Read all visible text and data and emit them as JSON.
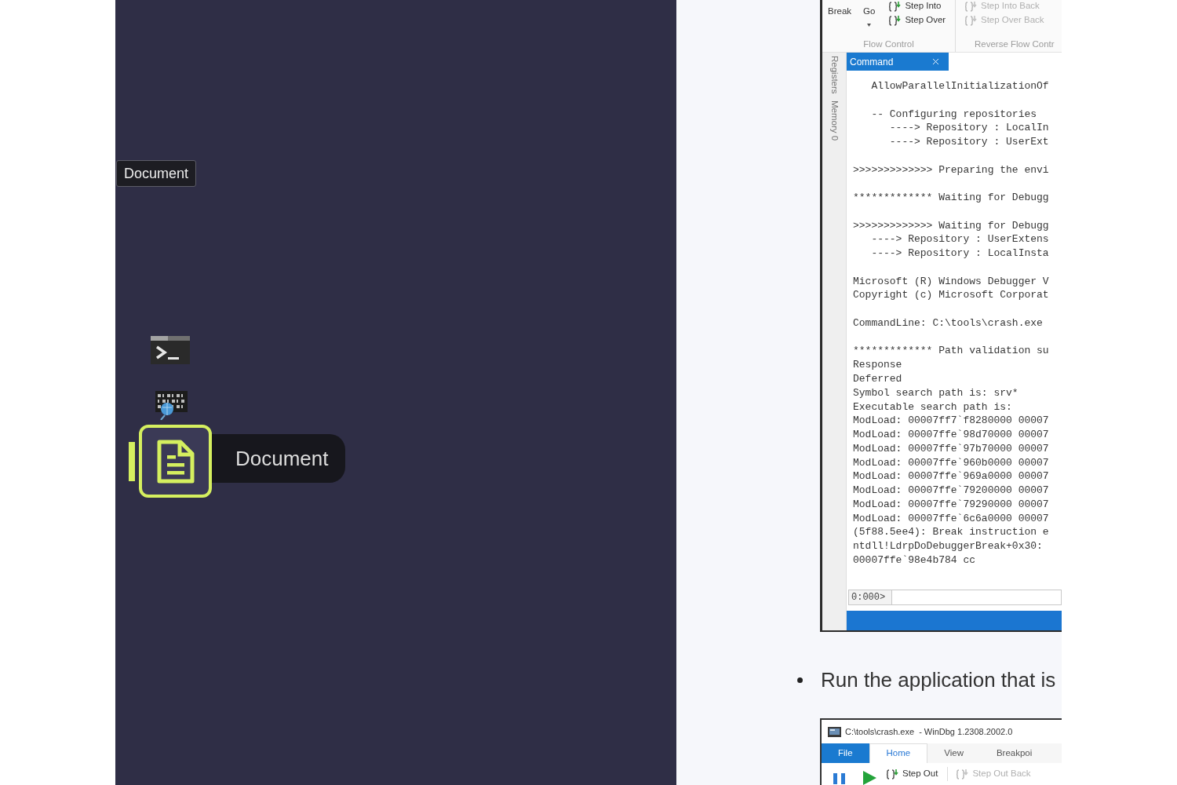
{
  "sidebar": {
    "tooltip": "Document",
    "items": [
      {
        "kind": "console",
        "selected": false
      },
      {
        "kind": "binary",
        "selected": false
      },
      {
        "kind": "document",
        "selected": true,
        "label": "Document"
      }
    ]
  },
  "article": {
    "figure_1": {
      "ribbon": [
        {
          "label": "Flow Control",
          "large": [
            {
              "label": "Break",
              "dropdown": false
            },
            {
              "label": "Go",
              "dropdown": true
            }
          ],
          "small": [
            {
              "label": "Step Into",
              "disabled": false
            },
            {
              "label": "Step Over",
              "disabled": false
            }
          ]
        },
        {
          "label": "Reverse Flow Contr",
          "small": [
            {
              "label": "Step Into Back",
              "disabled": true
            },
            {
              "label": "Step Over Back",
              "disabled": true
            }
          ]
        }
      ],
      "side_tabs": [
        "Registers",
        "Memory 0"
      ],
      "panel_tab": "Command",
      "output": [
        [
          "   AllowParallelInitializationOf"
        ],
        [
          "   -- Configuring repositories",
          "      ----> Repository : LocalIn",
          "      ----> Repository : UserExt"
        ],
        [
          ">>>>>>>>>>>>> Preparing the envi"
        ],
        [
          "************* Waiting for Debugg"
        ],
        [
          ">>>>>>>>>>>>> Waiting for Debugg",
          "   ----> Repository : UserExtens",
          "   ----> Repository : LocalInsta"
        ],
        [
          "Microsoft (R) Windows Debugger V",
          "Copyright (c) Microsoft Corporat"
        ],
        [
          "CommandLine: C:\\tools\\crash.exe"
        ],
        [
          "************* Path validation su",
          "Response",
          "Deferred",
          "Symbol search path is: srv*",
          "Executable search path is:",
          "ModLoad: 00007ff7`f8280000 00007",
          "ModLoad: 00007ffe`98d70000 00007",
          "ModLoad: 00007ffe`97b70000 00007",
          "ModLoad: 00007ffe`960b0000 00007",
          "ModLoad: 00007ffe`969a0000 00007",
          "ModLoad: 00007ffe`79200000 00007",
          "ModLoad: 00007ffe`79290000 00007",
          "ModLoad: 00007ffe`6c6a0000 00007",
          "(5f88.5ee4): Break instruction e",
          "ntdll!LdrpDoDebuggerBreak+0x30:",
          "00007ffe`98e4b784 cc"
        ]
      ],
      "prompt": "0:000>"
    },
    "bullets": [
      "Run the application that is"
    ],
    "figure_2": {
      "title": "C:\\tools\\crash.exe  - WinDbg 1.2308.2002.0",
      "tabs": [
        {
          "label": "File",
          "kind": "menu",
          "selected": false
        },
        {
          "label": "Home",
          "kind": "tab",
          "selected": true
        },
        {
          "label": "View",
          "kind": "tab",
          "selected": false
        },
        {
          "label": "Breakpoi",
          "kind": "tab",
          "selected": false
        }
      ],
      "commands": [
        {
          "label": "Step Out",
          "disabled": false
        },
        {
          "label": "Step Out Back",
          "disabled": true
        }
      ]
    }
  }
}
